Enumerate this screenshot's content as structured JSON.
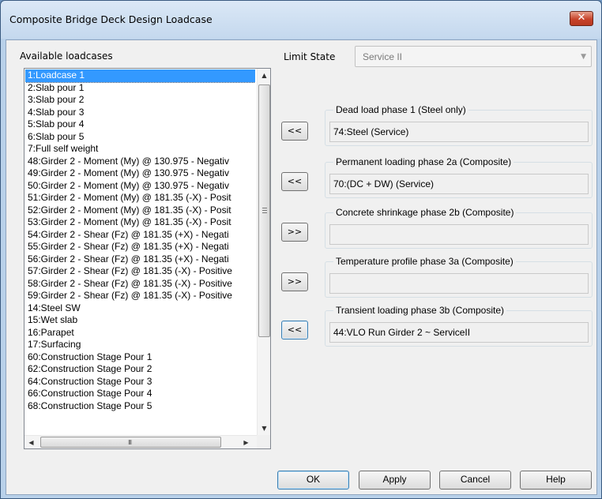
{
  "window": {
    "title": "Composite Bridge Deck Design Loadcase",
    "close_glyph": "✕"
  },
  "available": {
    "label": "Available loadcases",
    "items": [
      "1:Loadcase 1",
      "2:Slab pour 1",
      "3:Slab pour 2",
      "4:Slab pour 3",
      "5:Slab pour 4",
      "6:Slab pour 5",
      "7:Full self weight",
      "48:Girder 2 - Moment (My) @ 130.975 - Negativ",
      "49:Girder 2 - Moment (My) @ 130.975 - Negativ",
      "50:Girder 2 - Moment (My) @ 130.975 - Negativ",
      "51:Girder 2 - Moment (My) @ 181.35 (-X) - Posit",
      "52:Girder 2 - Moment (My) @ 181.35 (-X) - Posit",
      "53:Girder 2 - Moment (My) @ 181.35 (-X) - Posit",
      "54:Girder 2 - Shear (Fz) @ 181.35 (+X) - Negati",
      "55:Girder 2 - Shear (Fz) @ 181.35 (+X) - Negati",
      "56:Girder 2 - Shear (Fz) @ 181.35 (+X) - Negati",
      "57:Girder 2 - Shear (Fz) @ 181.35 (-X) - Positive",
      "58:Girder 2 - Shear (Fz) @ 181.35 (-X) - Positive",
      "59:Girder 2 - Shear (Fz) @ 181.35 (-X) - Positive",
      "14:Steel SW",
      "15:Wet slab",
      "16:Parapet",
      "17:Surfacing",
      "60:Construction Stage Pour 1",
      "62:Construction Stage Pour 2",
      "64:Construction Stage Pour 3",
      "66:Construction Stage Pour 4",
      "68:Construction Stage Pour 5"
    ],
    "selected_index": 0,
    "scroll_up_glyph": "▲",
    "scroll_down_glyph": "▼",
    "scroll_left_glyph": "◀",
    "scroll_right_glyph": "▶",
    "hgrip_glyph": "III"
  },
  "limit_state": {
    "label": "Limit State",
    "value": "Service II",
    "arrow_glyph": "▼"
  },
  "phases": [
    {
      "title": "Dead load phase 1 (Steel only)",
      "value": "74:Steel (Service)",
      "button": "<<"
    },
    {
      "title": "Permanent loading phase 2a (Composite)",
      "value": "70:(DC + DW) (Service)",
      "button": "<<"
    },
    {
      "title": "Concrete shrinkage phase 2b (Composite)",
      "value": "",
      "button": ">>"
    },
    {
      "title": "Temperature profile phase 3a (Composite)",
      "value": "",
      "button": ">>"
    },
    {
      "title": "Transient loading phase 3b (Composite)",
      "value": "44:VLO Run Girder 2 ~ ServiceII",
      "button": "<<"
    }
  ],
  "buttons": {
    "ok": "OK",
    "apply": "Apply",
    "cancel": "Cancel",
    "help": "Help"
  },
  "colors": {
    "selection": "#3399ff",
    "window_frame": "#b9d1ea",
    "close_button": "#c7432a"
  }
}
